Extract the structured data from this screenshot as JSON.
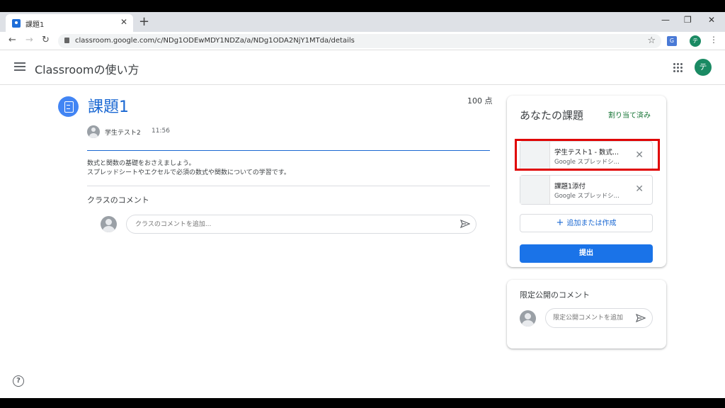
{
  "browser": {
    "tab_title": "課題1",
    "url": "classroom.google.com/c/NDg1ODEwMDY1NDZa/a/NDg1ODA2NjY1MTda/details",
    "profile_initial": "テ",
    "translate_badge": "G"
  },
  "header": {
    "app_title": "Classroomの使い方",
    "avatar_initial": "テ"
  },
  "assignment": {
    "title": "課題1",
    "points": "100 点",
    "author": "学生テスト2",
    "time": "11:56",
    "description_line1": "数式と関数の基礎をおさえましょう。",
    "description_line2": "スプレッドシートやエクセルで必須の数式や関数についての学習です。"
  },
  "class_comments": {
    "label": "クラスのコメント",
    "placeholder": "クラスのコメントを追加..."
  },
  "your_work": {
    "title": "あなたの課題",
    "status": "割り当て済み",
    "files": [
      {
        "name": "学生テスト1 - 数式...",
        "type": "Google スプレッドシ..."
      },
      {
        "name": "課題1添付",
        "type": "Google スプレッドシ..."
      }
    ],
    "add_label": "追加または作成",
    "submit_label": "提出"
  },
  "private_comments": {
    "label": "限定公開のコメント",
    "placeholder": "限定公開コメントを追加"
  },
  "help": "?"
}
